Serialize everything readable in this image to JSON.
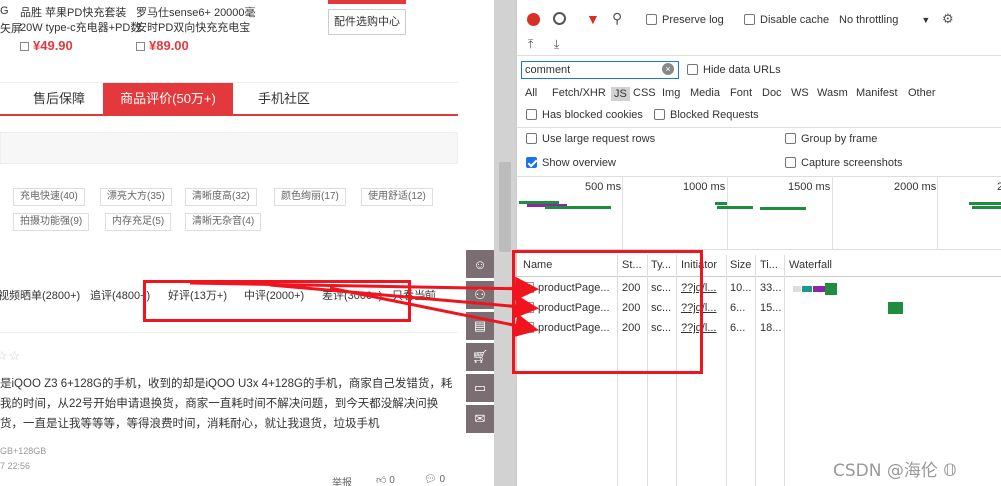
{
  "products": [
    {
      "line1": "G",
      "line2": "矢屏",
      "price": "",
      "box_left": 0
    },
    {
      "title": "品胜 苹果PD快充套装",
      "subtitle": "20W type-c充电器+PD数",
      "price": "¥49.90"
    },
    {
      "title": "罗马仕sense6+ 20000毫",
      "subtitle": "安时PD双向快充充电宝",
      "price": "¥89.00"
    }
  ],
  "accessory_button": "配件选购中心",
  "tabs": [
    "售后保障",
    "商品评价(50万+)",
    "手机社区"
  ],
  "tags": [
    "充电快速(40)",
    "漂亮大方(35)",
    "清晰度高(32)",
    "颜色绚丽(17)",
    "使用舒适(12)",
    "拍摄功能强(9)",
    "内存充足(5)",
    "清晰无杂音(4)"
  ],
  "filter_tabs": [
    "视频晒单(2800+)",
    "追评(4800+)",
    "好评(13万+)",
    "中评(2000+)",
    "差评(3000+)",
    "只看当前"
  ],
  "review": {
    "stars": "☆☆",
    "text": "是iQOO Z3 6+128G的手机，收到的却是iQOO U3x 4+128G的手机，商家自己发错货，耗我的时间，从22号开始申请退换货，商家一直耗时间不解决问题，到今天都没解决问换货，一直是让我等等等，等得浪费时间，消耗耐心，就让我退货，垃圾手机",
    "spec": "GB+128GB",
    "time": "7 22:56",
    "report": "举报",
    "likes": "0",
    "comments": "0"
  },
  "devtools": {
    "toolbar": {
      "preserve_log": "Preserve log",
      "disable_cache": "Disable cache",
      "throttle": "No throttling"
    },
    "filter_value": "comment",
    "hide_data_urls": "Hide data URLs",
    "types": [
      "All",
      "Fetch/XHR",
      "JS",
      "CSS",
      "Img",
      "Media",
      "Font",
      "Doc",
      "WS",
      "Wasm",
      "Manifest",
      "Other"
    ],
    "has_blocked_cookies": "Has blocked cookies",
    "blocked_requests": "Blocked Requests",
    "large_rows": "Use large request rows",
    "group_by_frame": "Group by frame",
    "show_overview": "Show overview",
    "capture_screenshots": "Capture screenshots",
    "ticks": [
      "500 ms",
      "1000 ms",
      "1500 ms",
      "2000 ms",
      "2"
    ],
    "columns": [
      "Name",
      "St...",
      "Ty...",
      "Initiator",
      "Size",
      "Ti...",
      "Waterfall"
    ],
    "requests": [
      {
        "name": "productPage...",
        "status": "200",
        "type": "sc...",
        "initiator": "??jq/l...",
        "size": "10...",
        "time": "33..."
      },
      {
        "name": "productPage...",
        "status": "200",
        "type": "sc...",
        "initiator": "??jq/l...",
        "size": "6...",
        "time": "15..."
      },
      {
        "name": "productPage...",
        "status": "200",
        "type": "sc...",
        "initiator": "??jq/l...",
        "size": "6...",
        "time": "18..."
      }
    ]
  },
  "watermark": "CSDN @海伦 𝕆",
  "colors": {
    "accent": "#e4393c",
    "annotation": "#f0141e",
    "devtools_blue": "#1a73e8"
  }
}
